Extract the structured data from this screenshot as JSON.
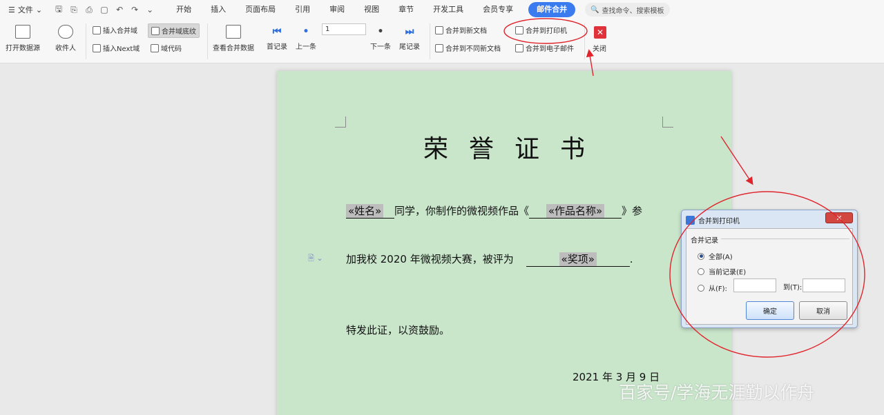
{
  "menubar": {
    "file_label": "文件",
    "tabs": [
      "开始",
      "插入",
      "页面布局",
      "引用",
      "审阅",
      "视图",
      "章节",
      "开发工具",
      "会员专享"
    ],
    "active_tab": "邮件合并",
    "search_placeholder": "查找命令、搜索模板"
  },
  "ribbon": {
    "open_datasource": "打开数据源",
    "recipients": "收件人",
    "insert_merge_field": "插入合并域",
    "merge_field_shading": "合并域底纹",
    "insert_next_field": "插入Next域",
    "field_codes": "域代码",
    "view_merged_data": "查看合并数据",
    "first_record": "首记录",
    "previous_record": "上一条",
    "record_number": "1",
    "next_record": "下一条",
    "last_record": "尾记录",
    "merge_to_new_document": "合并到新文档",
    "merge_to_different_documents": "合并到不同新文档",
    "merge_to_printer": "合并到打印机",
    "merge_to_email": "合并到电子邮件",
    "close": "关闭"
  },
  "document": {
    "title": "荣誉证书",
    "name_field": "«姓名»",
    "text_1": "同学，你制作的微视频作品《",
    "work_field": "«作品名称»",
    "text_2": "》参",
    "text_3": "加我校 2020 年微视频大赛，被评为",
    "award_field": "«奖项»",
    "text_4": ".",
    "text_5": "特发此证，以资鼓励。",
    "date": "2021 年 3 月 9 日"
  },
  "dialog": {
    "title": "合并到打印机",
    "group_label": "合并记录",
    "option_all": "全部(A)",
    "option_current": "当前记录(E)",
    "option_from": "从(F):",
    "to_label": "到(T):",
    "from_value": "",
    "to_value": "",
    "ok": "确定",
    "cancel": "取消",
    "selected_option": "all"
  },
  "watermark": "百家号/学海无涯勤以作舟",
  "colors": {
    "accent": "#3a7cf0",
    "page_background": "#c9e6cb",
    "annotation": "#e0242c",
    "close_button": "#e0323a"
  }
}
